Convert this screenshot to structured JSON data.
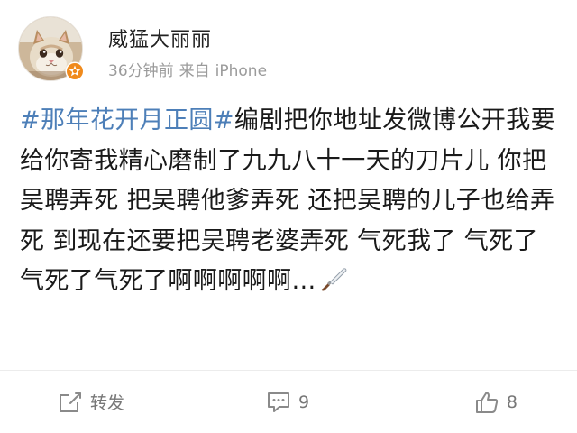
{
  "post": {
    "user": {
      "name": "威猛大丽丽",
      "avatar_icon": "cat-avatar",
      "badge_icon": "verified-star-badge-icon"
    },
    "meta": {
      "time": "36分钟前",
      "source_prefix": "来自",
      "source": "iPhone"
    },
    "content": {
      "topic": "#那年花开月正圆#",
      "text": "编剧把你地址发微博公开我要给你寄我精心磨制了九九八十一天的刀片儿 你把吴聘弄死 把吴聘他爹弄死 还把吴聘的儿子也给弄死 到现在还要把吴聘老婆弄死 气死我了 气死了气死了气死了啊啊啊啊啊…",
      "emoji": "knife-icon"
    },
    "actions": {
      "repost_label": "转发",
      "comment_count": "9",
      "like_count": "8"
    },
    "colors": {
      "topic_link": "#4d7fb8",
      "meta_gray": "#9b9b9b",
      "action_gray": "#777777",
      "badge_orange": "#f08a1c"
    }
  }
}
